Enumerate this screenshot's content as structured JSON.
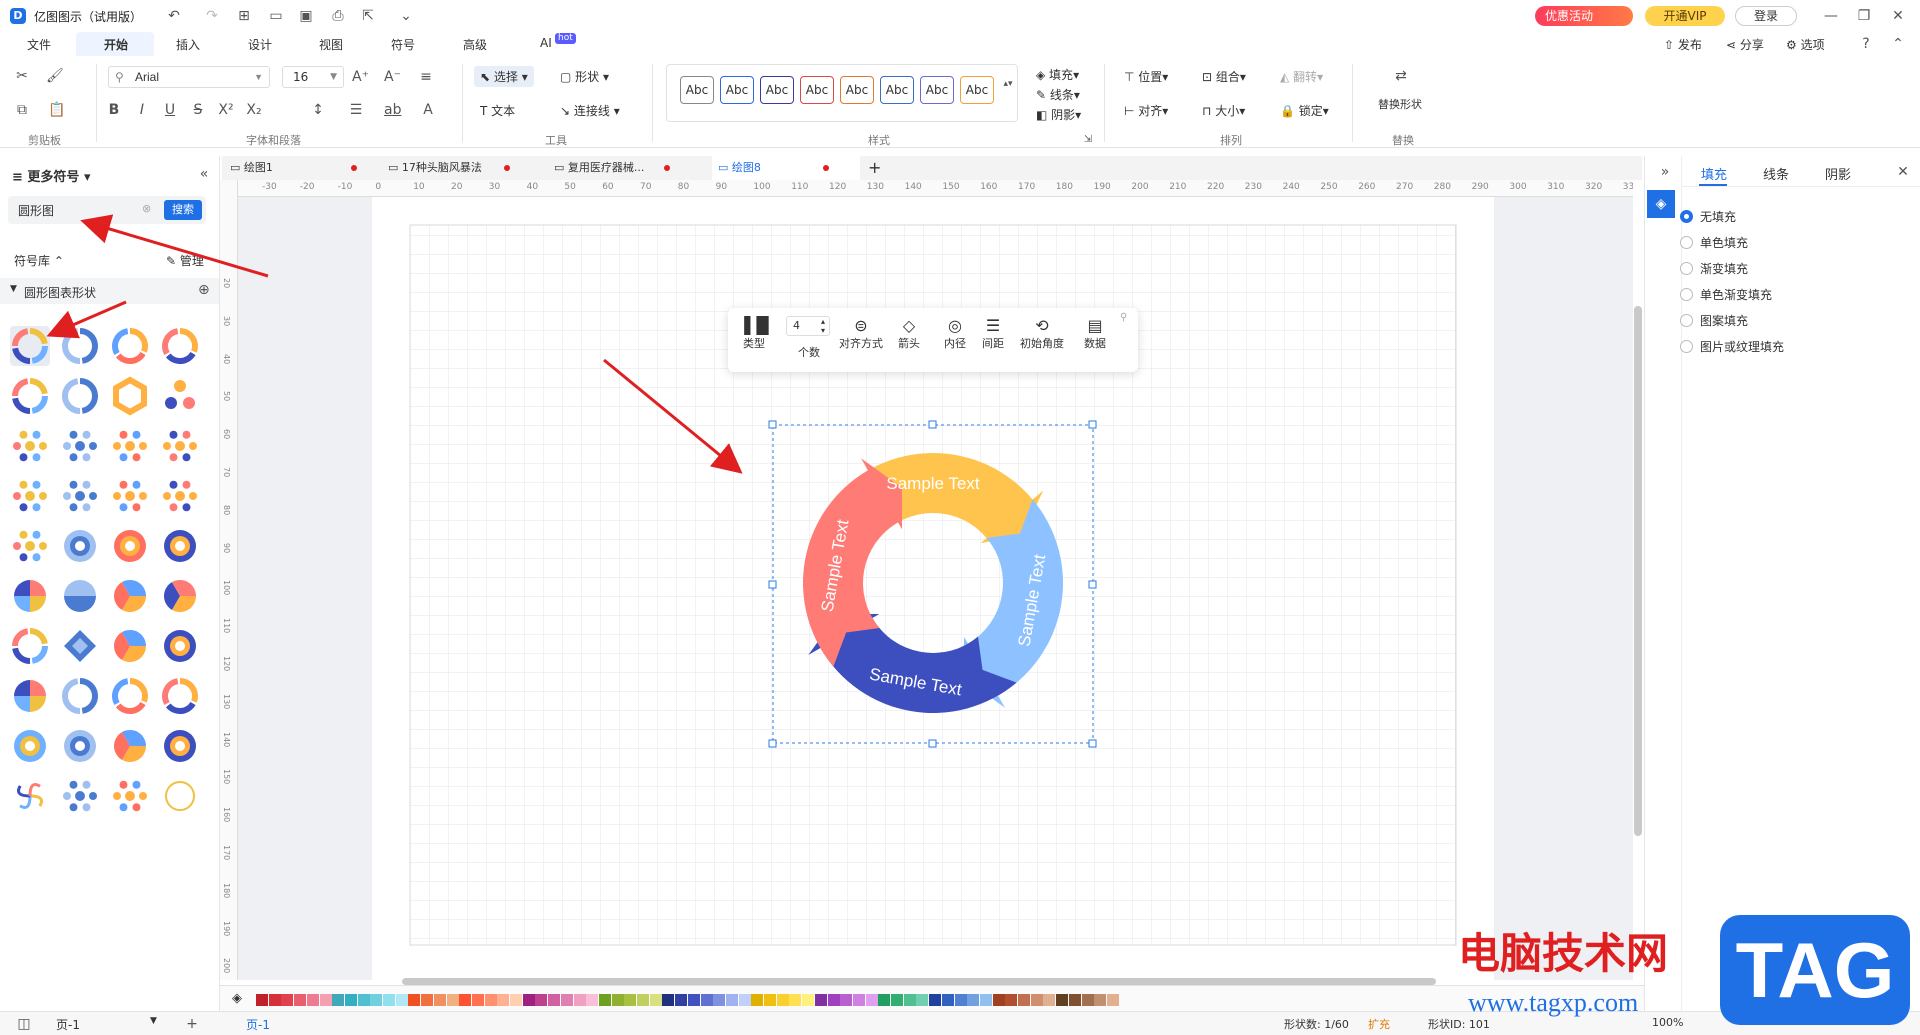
{
  "app": {
    "title": "亿图图示（试用版）"
  },
  "titlebar": {
    "promo": "优惠活动",
    "vip": "开通VIP",
    "login": "登录"
  },
  "menu": {
    "items": [
      "文件",
      "开始",
      "插入",
      "设计",
      "视图",
      "符号",
      "高级",
      "AI"
    ],
    "active": "开始",
    "ai_badge": "hot",
    "right": [
      "发布",
      "分享",
      "选项"
    ]
  },
  "ribbon": {
    "font": "Arial",
    "size": "16",
    "groups": [
      "剪贴板",
      "字体和段落",
      "工具",
      "样式",
      "排列",
      "替换"
    ],
    "tools": {
      "select": "选择",
      "shape": "形状",
      "text": "文本",
      "connector": "连接线"
    },
    "style_labels": [
      "Abc",
      "Abc",
      "Abc",
      "Abc",
      "Abc",
      "Abc",
      "Abc",
      "Abc"
    ],
    "style_colors": [
      "#888888",
      "#2f6bd8",
      "#3a3a9a",
      "#d84a4a",
      "#e07a30",
      "#3a70c0",
      "#6a6ad0",
      "#f0a040"
    ],
    "fill": "填充",
    "line": "线条",
    "shadow": "阴影",
    "position": "位置",
    "group": "组合",
    "rotate": "翻转",
    "align": "对齐",
    "size_btn": "大小",
    "lock": "锁定",
    "replace": "替换形状"
  },
  "left": {
    "title": "更多符号",
    "search_value": "圆形图",
    "search_btn": "搜索",
    "library": "符号库",
    "manage": "管理",
    "category": "圆形图表形状"
  },
  "tabs": [
    {
      "label": "绘图1",
      "active": false
    },
    {
      "label": "17种头脑风暴法",
      "active": false
    },
    {
      "label": "复用医疗器械...",
      "active": false
    },
    {
      "label": "绘图8",
      "active": true
    }
  ],
  "hruler": [
    "-30",
    "-20",
    "-10",
    "0",
    "10",
    "20",
    "30",
    "40",
    "50",
    "60",
    "70",
    "80",
    "90",
    "100",
    "110",
    "120",
    "130",
    "140",
    "150",
    "160",
    "170",
    "180",
    "190",
    "200",
    "210",
    "220",
    "230",
    "240",
    "250",
    "260",
    "270",
    "280",
    "290",
    "300",
    "310",
    "320",
    "33"
  ],
  "vruler": [
    "20",
    "30",
    "40",
    "50",
    "60",
    "70",
    "80",
    "90",
    "100",
    "110",
    "120",
    "130",
    "140",
    "150",
    "160",
    "170",
    "180",
    "190",
    "200"
  ],
  "float_toolbar": {
    "count": "4",
    "items": [
      "类型",
      "个数",
      "对齐方式",
      "箭头",
      "内径",
      "间距",
      "初始角度",
      "数据"
    ]
  },
  "diagram": {
    "segments": [
      {
        "text": "Sample Text",
        "color": "#ffc44d"
      },
      {
        "text": "Sample Text",
        "color": "#8ec1ff"
      },
      {
        "text": "Sample Text",
        "color": "#3d4fbf"
      },
      {
        "text": "Sample Text",
        "color": "#ff7b76"
      }
    ]
  },
  "right": {
    "tabs": [
      "填充",
      "线条",
      "阴影"
    ],
    "options": [
      "无填充",
      "单色填充",
      "渐变填充",
      "单色渐变填充",
      "图案填充",
      "图片或纹理填充"
    ],
    "selected": "无填充"
  },
  "palette": [
    "#c0202a",
    "#d6303a",
    "#e04050",
    "#e86070",
    "#f07a90",
    "#f4a0b0",
    "#40a8b8",
    "#30b0c0",
    "#50c0d0",
    "#70d0e0",
    "#90e0f0",
    "#b0e8f8",
    "#f05020",
    "#f07040",
    "#f09060",
    "#f0b080",
    "#ff5030",
    "#ff7050",
    "#ff9070",
    "#ffb090",
    "#ffd0b0",
    "#a02080",
    "#c04090",
    "#d060a0",
    "#e080b0",
    "#f0a0c0",
    "#f8c0d8",
    "#70a020",
    "#90b030",
    "#a8c040",
    "#c0d060",
    "#d8e080",
    "#203080",
    "#3040a0",
    "#4050c0",
    "#6070d0",
    "#8090e0",
    "#a0b0f0",
    "#c0d0f8",
    "#e0b000",
    "#f0c010",
    "#f8d030",
    "#ffe050",
    "#fff080",
    "#8030a0",
    "#a040c0",
    "#b860d0",
    "#d080e0",
    "#e0a0f0",
    "#20a060",
    "#30b070",
    "#50c090",
    "#70d0b0",
    "#2040a0",
    "#3060c0",
    "#5080d0",
    "#70a0e0",
    "#90c0f0",
    "#a04020",
    "#b05030",
    "#c07050",
    "#d09070",
    "#e0b090",
    "#604020",
    "#805030",
    "#a07050",
    "#c09070",
    "#e0b090"
  ],
  "status": {
    "page": "页-1",
    "page_tab": "页-1",
    "shape_count": "形状数: 1/60",
    "expand": "扩充",
    "shape_id": "形状ID: 101",
    "zoom": "100%"
  },
  "watermark": {
    "cn": "电脑技术网",
    "url": "www.tagxp.com",
    "tag": "TAG"
  }
}
